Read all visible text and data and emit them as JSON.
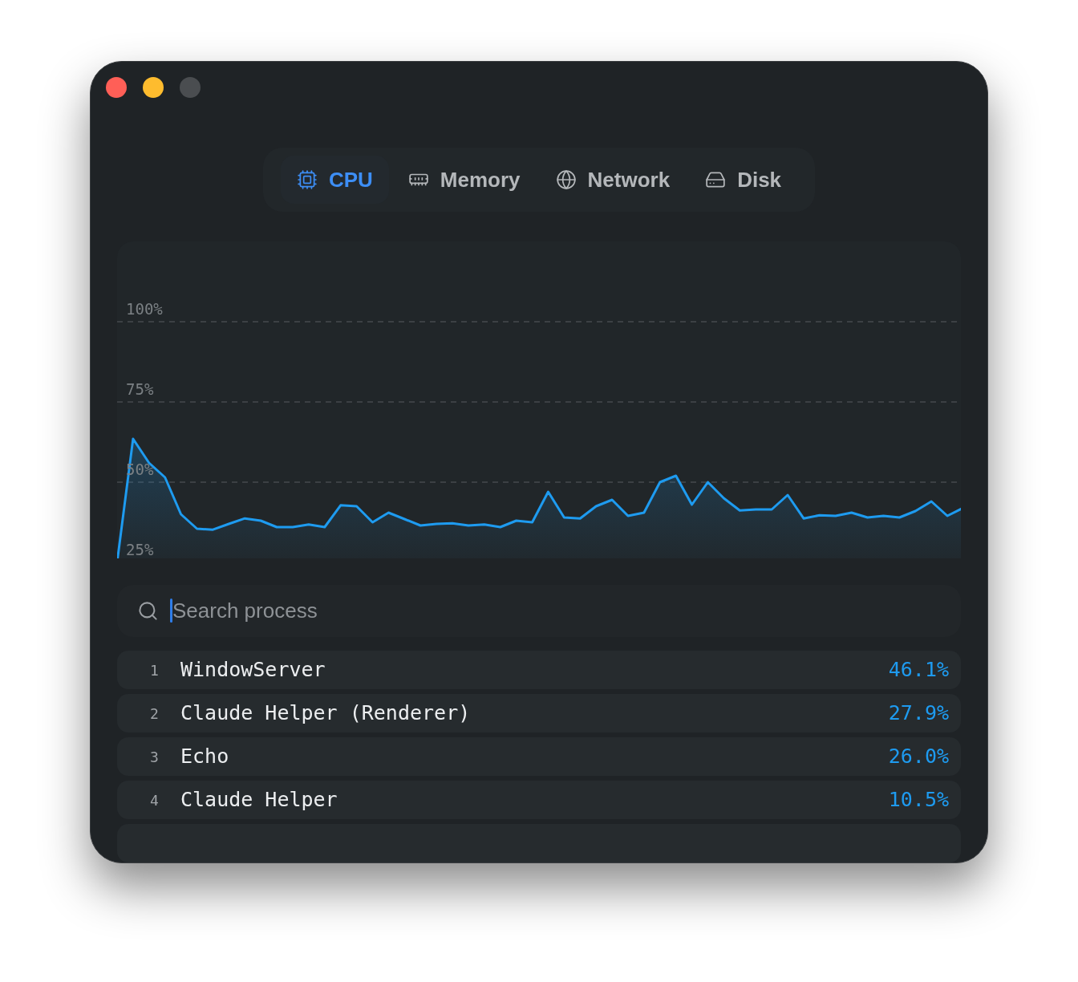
{
  "tabs": [
    {
      "label": "CPU",
      "selected": true
    },
    {
      "label": "Memory",
      "selected": false
    },
    {
      "label": "Network",
      "selected": false
    },
    {
      "label": "Disk",
      "selected": false
    }
  ],
  "chart": {
    "chart_data": {
      "type": "area",
      "grid": true,
      "ylim": [
        25,
        125
      ],
      "yticks": [
        {
          "value": 25,
          "label": "25%"
        },
        {
          "value": 50,
          "label": "50%"
        },
        {
          "value": 75,
          "label": "75%"
        },
        {
          "value": 100,
          "label": "100%"
        }
      ],
      "series": [
        {
          "color": "#1e9bf0",
          "values": [
            25,
            63.5,
            56,
            51.5,
            40,
            35.5,
            35.2,
            37,
            38.7,
            38,
            36,
            36,
            36.8,
            36,
            42.8,
            42.5,
            37.5,
            40.5,
            38.5,
            36.5,
            37,
            37.2,
            36.5,
            36.8,
            36,
            38,
            37.5,
            47,
            39,
            38.7,
            42.5,
            44.5,
            39.5,
            40.5,
            50,
            52,
            43,
            50,
            45,
            41.2,
            41.5,
            41.5,
            46,
            38.7,
            39.7,
            39.5,
            40.5,
            39,
            39.5,
            39,
            41,
            44,
            39.5,
            42
          ]
        }
      ]
    }
  },
  "search": {
    "placeholder": "Search process",
    "focused": true
  },
  "processes": [
    {
      "rank": "1",
      "name": "WindowServer",
      "usage": "46.1%"
    },
    {
      "rank": "2",
      "name": "Claude Helper (Renderer)",
      "usage": "27.9%"
    },
    {
      "rank": "3",
      "name": "Echo",
      "usage": "26.0%"
    },
    {
      "rank": "4",
      "name": "Claude Helper",
      "usage": "10.5%"
    }
  ]
}
